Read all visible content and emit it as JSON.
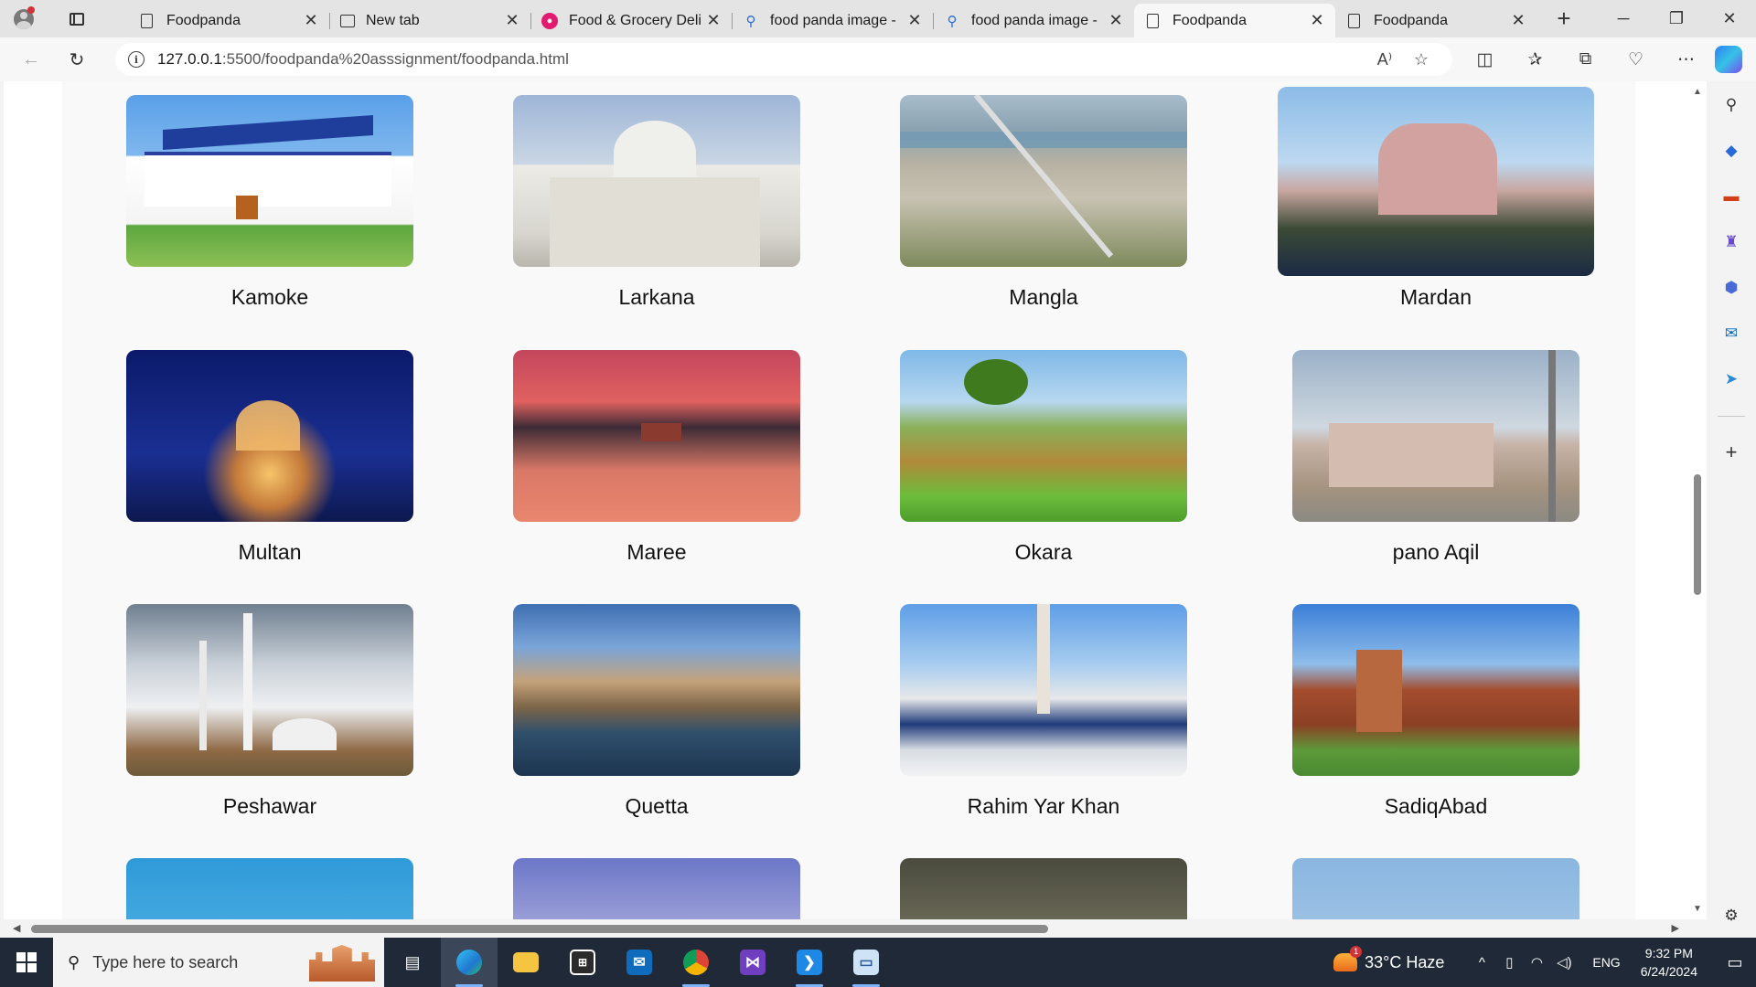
{
  "browser": {
    "tabs": [
      {
        "title": "Foodpanda",
        "icon": "page-icon",
        "active": false
      },
      {
        "title": "New tab",
        "icon": "newtab-icon",
        "active": false
      },
      {
        "title": "Food & Grocery Deli",
        "icon": "foodpanda-favicon-icon",
        "active": false
      },
      {
        "title": "food panda image - ",
        "icon": "search-favicon-icon",
        "active": false
      },
      {
        "title": "food panda image - ",
        "icon": "search-favicon-icon",
        "active": false
      },
      {
        "title": "Foodpanda",
        "icon": "page-icon",
        "active": true
      },
      {
        "title": "Foodpanda",
        "icon": "page-icon",
        "active": false
      }
    ],
    "url_host": "127.0.0.1",
    "url_rest": ":5500/foodpanda%20asssignment/foodpanda.html"
  },
  "cities": [
    {
      "name": "Kamoke",
      "image": "kamoke"
    },
    {
      "name": "Larkana",
      "image": "larkana"
    },
    {
      "name": "Mangla",
      "image": "mangla"
    },
    {
      "name": "Mardan",
      "image": "mardan"
    },
    {
      "name": "Multan",
      "image": "multan"
    },
    {
      "name": "Maree",
      "image": "maree"
    },
    {
      "name": "Okara",
      "image": "okara"
    },
    {
      "name": "pano Aqil",
      "image": "panoaqil"
    },
    {
      "name": "Peshawar",
      "image": "peshawar"
    },
    {
      "name": "Quetta",
      "image": "quetta"
    },
    {
      "name": "Rahim Yar Khan",
      "image": "rahim"
    },
    {
      "name": "SadiqAbad",
      "image": "sadiq"
    }
  ],
  "taskbar": {
    "search_placeholder": "Type here to search",
    "weather": "33°C  Haze",
    "weather_badge": "1",
    "language": "ENG",
    "time": "9:32 PM",
    "date": "6/24/2024"
  }
}
